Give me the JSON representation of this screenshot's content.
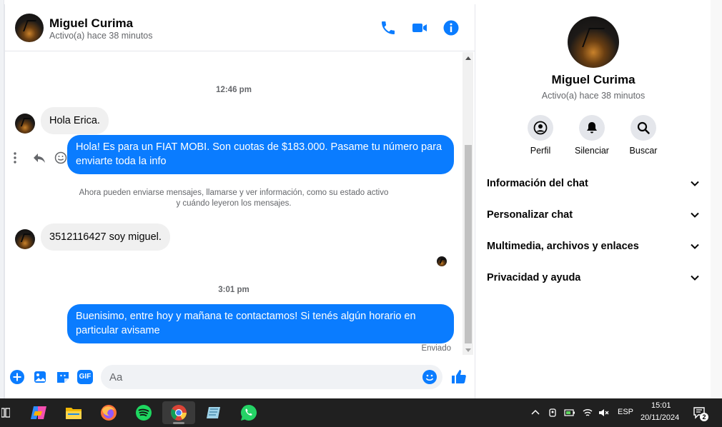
{
  "conversation": {
    "contact_name": "Miguel Curima",
    "contact_status": "Activo(a) hace 38 minutos",
    "header_icons": [
      "phone-icon",
      "video-camera-icon",
      "info-icon"
    ]
  },
  "messages": {
    "time_1": "12:46 pm",
    "incoming_1": "Hola Erica.",
    "outgoing_1": "Hola! Es para un FIAT MOBI. Son cuotas de $183.000. Pasame tu número para enviarte toda la info",
    "system_note": "Ahora pueden enviarse mensajes, llamarse y ver información, como su estado activo y cuándo leyeron los mensajes.",
    "incoming_2": "3512116427 soy miguel.",
    "time_2": "3:01 pm",
    "outgoing_2": "Buenisimo, entre hoy y mañana te contactamos! Si tenés algún horario en particular avisame",
    "sent_label": "Enviado"
  },
  "composer": {
    "placeholder": "Aa",
    "icons": [
      "add-icon",
      "image-icon",
      "sticker-icon",
      "gif-icon",
      "emoji-icon",
      "like-icon"
    ],
    "gif_label": "GIF"
  },
  "sidebar": {
    "name": "Miguel Curima",
    "status": "Activo(a) hace 38 minutos",
    "buttons": [
      {
        "label": "Perfil",
        "icon": "profile-icon"
      },
      {
        "label": "Silenciar",
        "icon": "bell-icon"
      },
      {
        "label": "Buscar",
        "icon": "search-icon"
      }
    ],
    "sections": [
      {
        "label": "Información del chat"
      },
      {
        "label": "Personalizar chat"
      },
      {
        "label": "Multimedia, archivos y enlaces"
      },
      {
        "label": "Privacidad y ayuda"
      }
    ]
  },
  "taskbar": {
    "apps": [
      "copilot-icon",
      "file-explorer-icon",
      "firefox-icon",
      "spotify-icon",
      "chrome-icon",
      "notepad-icon",
      "whatsapp-icon"
    ],
    "language": "ESP",
    "time": "15:01",
    "date": "20/11/2024",
    "notification_count": "2"
  },
  "colors": {
    "accent": "#0a7cff",
    "bubble_in": "#f0f0f0",
    "taskbar": "#202020"
  }
}
